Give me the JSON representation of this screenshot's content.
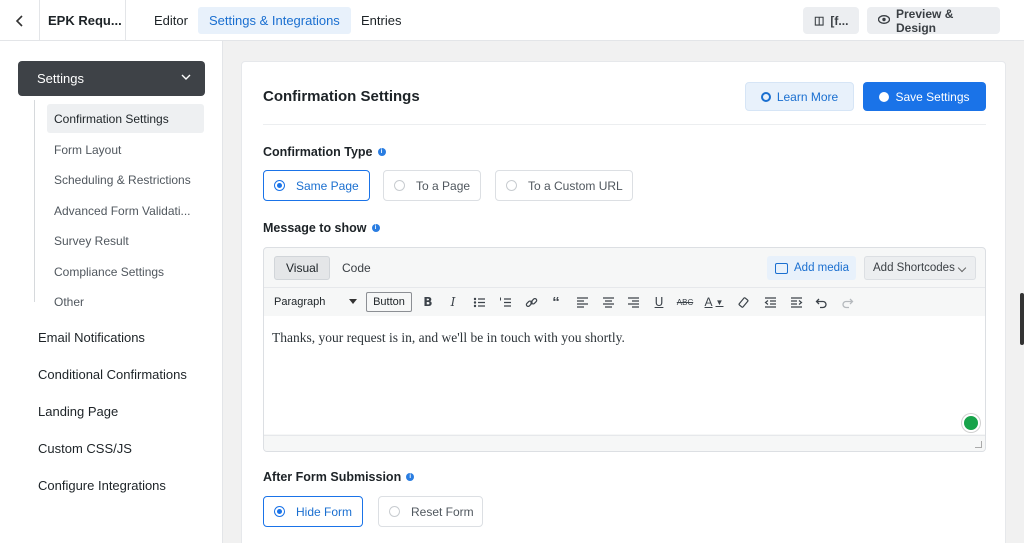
{
  "topbar": {
    "back_icon": "chevron-left-icon",
    "form_name": "EPK Requ...",
    "tabs": [
      {
        "label": "Editor"
      },
      {
        "label": "Settings & Integrations"
      },
      {
        "label": "Entries"
      }
    ],
    "shortcode_button": "[f...",
    "preview_button": "Preview & Design"
  },
  "sidebar": {
    "section_label": "Settings",
    "sub_items": [
      {
        "label": "Confirmation Settings"
      },
      {
        "label": "Form Layout"
      },
      {
        "label": "Scheduling & Restrictions"
      },
      {
        "label": "Advanced Form Validati..."
      },
      {
        "label": "Survey Result"
      },
      {
        "label": "Compliance Settings"
      },
      {
        "label": "Other"
      }
    ],
    "main_items": [
      {
        "label": "Email Notifications"
      },
      {
        "label": "Conditional Confirmations"
      },
      {
        "label": "Landing Page"
      },
      {
        "label": "Custom CSS/JS"
      },
      {
        "label": "Configure Integrations"
      }
    ]
  },
  "card": {
    "title": "Confirmation Settings",
    "learn_more": "Learn More",
    "save_settings": "Save Settings",
    "confirmation_type": {
      "label": "Confirmation Type",
      "options": [
        {
          "label": "Same Page",
          "selected": true
        },
        {
          "label": "To a Page",
          "selected": false
        },
        {
          "label": "To a Custom URL",
          "selected": false
        }
      ]
    },
    "message": {
      "label": "Message to show",
      "tab_visual": "Visual",
      "tab_code": "Code",
      "add_media": "Add media",
      "add_shortcodes": "Add Shortcodes",
      "format_select": "Paragraph",
      "button_label": "Button",
      "content": "Thanks, your request is in, and we'll be in touch with you shortly."
    },
    "after_submission": {
      "label": "After Form Submission",
      "options": [
        {
          "label": "Hide Form",
          "selected": true
        },
        {
          "label": "Reset Form",
          "selected": false
        }
      ]
    }
  },
  "colors": {
    "accent": "#1a73e8",
    "sidebar_active": "#3e4247",
    "grammar_badge": "#17a34a"
  }
}
